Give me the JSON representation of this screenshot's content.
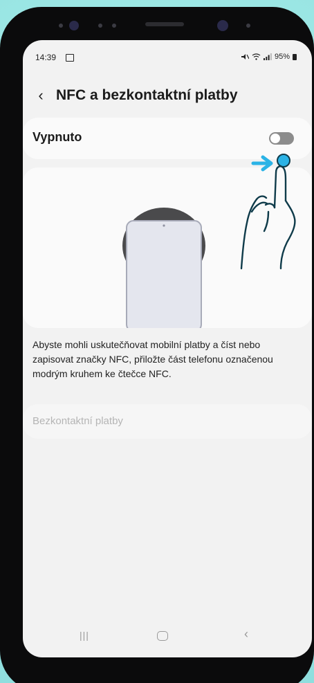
{
  "status_bar": {
    "time": "14:39",
    "battery": "95%"
  },
  "header": {
    "title": "NFC a bezkontaktní platby",
    "back_icon": "chevron-left-icon"
  },
  "nfc_toggle": {
    "label": "Vypnuto",
    "state": "off"
  },
  "description": "Abyste mohli uskutečňovat mobilní platby a číst nebo zapisovat značky NFC, přiložte část telefonu označenou modrým kruhem ke čtečce NFC.",
  "contactless_payments": {
    "label": "Bezkontaktní platby",
    "enabled": false
  },
  "colors": {
    "accent_arrow": "#2bb3e6",
    "tap_dot": "#2bb3e6",
    "hand_stroke": "#0f3b4a",
    "background": "#9fe9e6"
  }
}
